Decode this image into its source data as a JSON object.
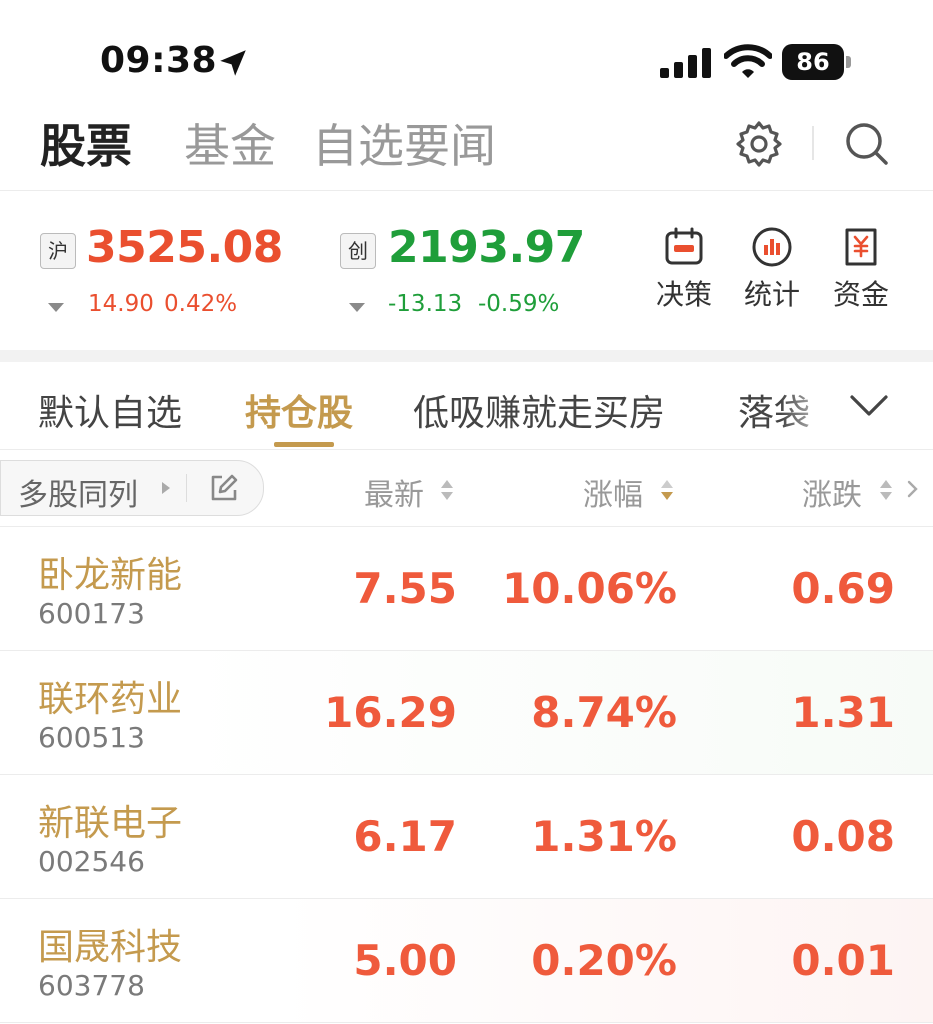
{
  "status_bar": {
    "time": "09:38",
    "battery": "86"
  },
  "top_tabs": [
    "股票",
    "基金",
    "自选要闻"
  ],
  "indices": [
    {
      "tag": "沪",
      "value": "3525.08",
      "change": "14.90",
      "change_pct": "0.42%",
      "color": "#ea4f2f"
    },
    {
      "tag": "创",
      "value": "2193.97",
      "change": "-13.13",
      "change_pct": "-0.59%",
      "color": "#1f9e3a"
    }
  ],
  "tools": [
    {
      "label": "决策",
      "icon": "calendar-decision-icon"
    },
    {
      "label": "统计",
      "icon": "bar-chart-circle-icon"
    },
    {
      "label": "资金",
      "icon": "yuan-document-icon"
    }
  ],
  "watchlist_tabs": [
    "默认自选",
    "持仓股",
    "低吸赚就走买房",
    "落袋"
  ],
  "active_watchlist_tab": 1,
  "table": {
    "multi_column_label": "多股同列",
    "columns": [
      "最新",
      "涨幅",
      "涨跌"
    ],
    "rows": [
      {
        "name": "卧龙新能",
        "code": "600173",
        "price": "7.55",
        "pct": "10.06%",
        "chg": "0.69"
      },
      {
        "name": "联环药业",
        "code": "600513",
        "price": "16.29",
        "pct": "8.74%",
        "chg": "1.31"
      },
      {
        "name": "新联电子",
        "code": "002546",
        "price": "6.17",
        "pct": "1.31%",
        "chg": "0.08"
      },
      {
        "name": "国晟科技",
        "code": "603778",
        "price": "5.00",
        "pct": "0.20%",
        "chg": "0.01"
      }
    ]
  },
  "colors": {
    "accent_gold": "#c49a4e",
    "up_red": "#ea4f2f",
    "down_green": "#1f9e3a"
  }
}
